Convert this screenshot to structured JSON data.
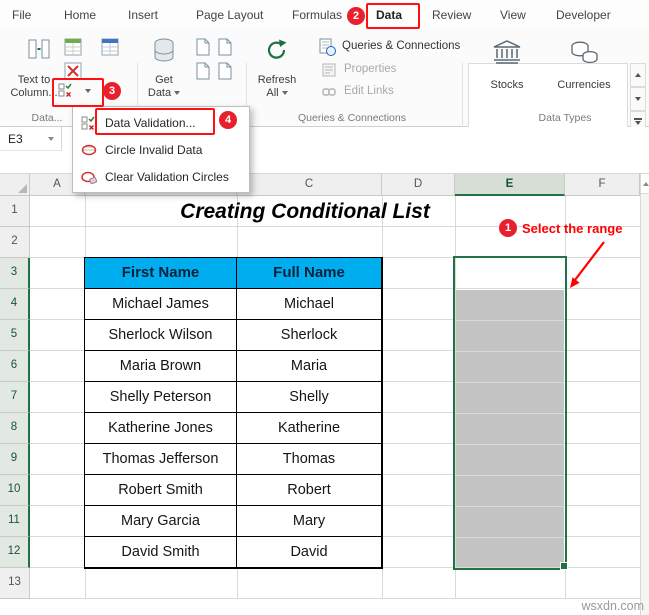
{
  "tabs": [
    "File",
    "Home",
    "Insert",
    "Page Layout",
    "Formulas",
    "Data",
    "Review",
    "View",
    "Developer"
  ],
  "ribbon": {
    "text_to_columns": {
      "line1": "Text to",
      "line2": "Column..."
    },
    "get_data": {
      "line1": "Get",
      "line2": "Data"
    },
    "refresh_all": {
      "line1": "Refresh",
      "line2": "All"
    },
    "queries_connections": "Queries & Connections",
    "properties": "Properties",
    "edit_links": "Edit Links",
    "stocks": "Stocks",
    "currencies": "Currencies",
    "group_labels": {
      "data_tools": "Data...",
      "queries": "Queries & Connections",
      "data_types": "Data Types"
    }
  },
  "menu": {
    "items": [
      "Data Validation...",
      "Circle Invalid Data",
      "Clear Validation Circles"
    ]
  },
  "formula_bar": {
    "name_box": "E3"
  },
  "annotations": {
    "steps": [
      {
        "num": "1",
        "label": "Select the range"
      },
      {
        "num": "2"
      },
      {
        "num": "3"
      },
      {
        "num": "4"
      }
    ]
  },
  "sheet": {
    "title": "Creating Conditional List",
    "col_headers": [
      "A",
      "B",
      "C",
      "D",
      "E",
      "F"
    ],
    "row_headers": [
      "1",
      "2",
      "3",
      "4",
      "5",
      "6",
      "7",
      "8",
      "9",
      "10",
      "11",
      "12",
      "13"
    ],
    "table": {
      "headers": [
        "First Name",
        "Full Name"
      ],
      "rows": [
        [
          "Michael James",
          "Michael"
        ],
        [
          "Sherlock Wilson",
          "Sherlock"
        ],
        [
          "Maria Brown",
          "Maria"
        ],
        [
          "Shelly Peterson",
          "Shelly"
        ],
        [
          "Katherine Jones",
          "Katherine"
        ],
        [
          "Thomas Jefferson",
          "Thomas"
        ],
        [
          "Robert Smith",
          "Robert"
        ],
        [
          "Mary Garcia",
          "Mary"
        ],
        [
          "David Smith",
          "David"
        ]
      ]
    }
  },
  "watermark": "wsxdn.com",
  "colors": {
    "annotation_red": "#ff1111",
    "excel_green": "#217346",
    "table_header_fill": "#00AEEF",
    "selection_fill": "#C3C3C3"
  }
}
